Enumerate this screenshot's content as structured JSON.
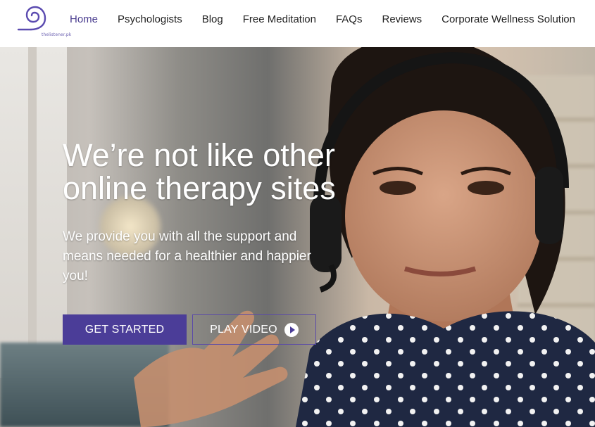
{
  "logo": {
    "text": "thelistener.pk",
    "icon": "spiral-logo-icon"
  },
  "nav": {
    "items": [
      {
        "label": "Home",
        "active": true
      },
      {
        "label": "Psychologists"
      },
      {
        "label": "Blog"
      },
      {
        "label": "Free Meditation"
      },
      {
        "label": "FAQs"
      },
      {
        "label": "Reviews"
      },
      {
        "label": "Corporate Wellness Solution"
      }
    ]
  },
  "hero": {
    "title": "We’re not like other online therapy sites",
    "subtitle": "We provide you with all the support and means needed for a healthier and happier you!",
    "primary_button": "GET STARTED",
    "secondary_button": "PLAY VIDEO",
    "secondary_icon": "play-circle-icon"
  },
  "colors": {
    "accent": "#4b3d98",
    "nav_active": "#4a3d8f",
    "nav_text": "#222222"
  }
}
